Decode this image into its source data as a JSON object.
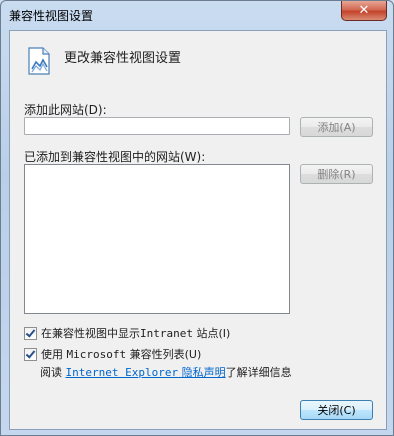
{
  "window": {
    "title": "兼容性视图设置",
    "close_glyph": "✕"
  },
  "header": {
    "text": "更改兼容性视图设置",
    "icon": "compat-page-icon"
  },
  "add_site": {
    "label": "添加此网站(D):",
    "value": "",
    "button": "添加(A)"
  },
  "site_list": {
    "label": "已添加到兼容性视图中的网站(W):",
    "items": [],
    "remove_button": "删除(R)"
  },
  "options": {
    "intranet": {
      "prefix": "在兼容性视图中显示 ",
      "mono": "Intranet",
      "suffix": " 站点(I)",
      "checked": true
    },
    "ms_list": {
      "prefix": "使用 ",
      "mono": "Microsoft",
      "suffix": " 兼容性列表(U)",
      "checked": true
    }
  },
  "privacy": {
    "prefix": "阅读 ",
    "link_mono": "Internet Explorer",
    "link_rest": " 隐私声明",
    "suffix": "了解详细信息"
  },
  "footer": {
    "close_button": "关闭(C)"
  }
}
